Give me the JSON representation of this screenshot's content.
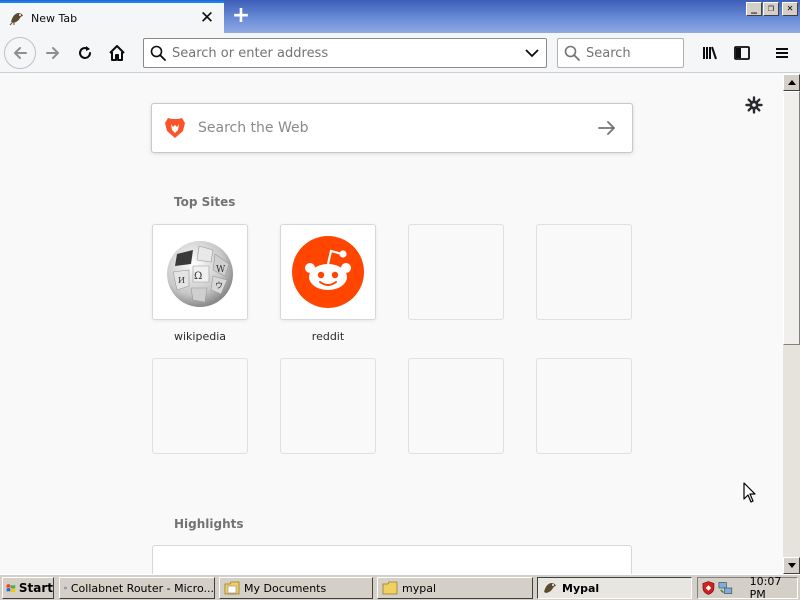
{
  "tab": {
    "title": "New Tab",
    "close_label": "✕"
  },
  "newtab_label": "+",
  "window_controls": {
    "minimize": "_",
    "restore": "❐",
    "close": "✕"
  },
  "urlbar": {
    "value": "",
    "placeholder": "Search or enter address"
  },
  "searchbar": {
    "value": "",
    "placeholder": "Search"
  },
  "web_search": {
    "placeholder": "Search the Web"
  },
  "top_sites": {
    "title": "Top Sites",
    "tiles": [
      {
        "label": "wikipedia",
        "icon": "wikipedia-globe-icon"
      },
      {
        "label": "reddit",
        "icon": "reddit-alien-icon"
      }
    ]
  },
  "highlights": {
    "title": "Highlights"
  },
  "taskbar": {
    "start_label": "Start",
    "tasks": [
      {
        "label": "Collabnet Router - Micro...",
        "icon": "ie-icon"
      },
      {
        "label": "My Documents",
        "icon": "folder-icon"
      },
      {
        "label": "mypal",
        "icon": "folder-icon"
      },
      {
        "label": "Mypal",
        "icon": "mypal-icon",
        "active": true
      }
    ],
    "clock": "10:07 PM"
  },
  "colors": {
    "accent": "#0a84ff",
    "reddit": "#ff4500",
    "brave": "#fb542b"
  }
}
